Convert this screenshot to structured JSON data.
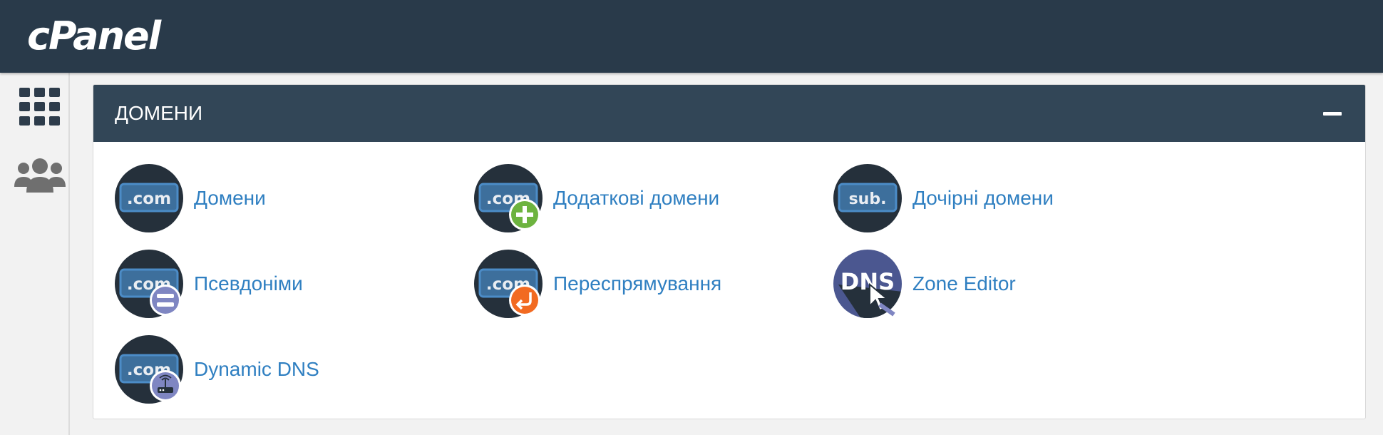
{
  "header": {
    "logo_text": "cPanel"
  },
  "sidebar": {
    "items": [
      {
        "icon": "grid-icon"
      },
      {
        "icon": "users-icon"
      }
    ]
  },
  "panel": {
    "title": "ДОМЕНИ",
    "collapse_icon": "minus-icon",
    "items": [
      {
        "label": "Домени",
        "icon": "com-icon",
        "badge": ""
      },
      {
        "label": "Додаткові домени",
        "icon": "com-icon",
        "badge": "plus"
      },
      {
        "label": "Дочірні домени",
        "icon": "sub-icon",
        "badge": ""
      },
      {
        "label": "Псевдоніми",
        "icon": "com-icon",
        "badge": "equals"
      },
      {
        "label": "Переспрямування",
        "icon": "com-icon",
        "badge": "redirect"
      },
      {
        "label": "Zone Editor",
        "icon": "dns-icon",
        "badge": ""
      },
      {
        "label": "Dynamic DNS",
        "icon": "com-icon",
        "badge": "router"
      }
    ],
    "icon_text": {
      "com": ".com",
      "sub": "sub.",
      "dns": "DNS"
    }
  },
  "colors": {
    "topbar": "#293a4a",
    "panel_header": "#324657",
    "link": "#2f7fc1",
    "icon_circle": "#25303b",
    "badge_plus": "#6db33f",
    "badge_equals": "#7f86c2",
    "badge_redirect": "#f26a21",
    "dns_circle": "#4b5790"
  }
}
